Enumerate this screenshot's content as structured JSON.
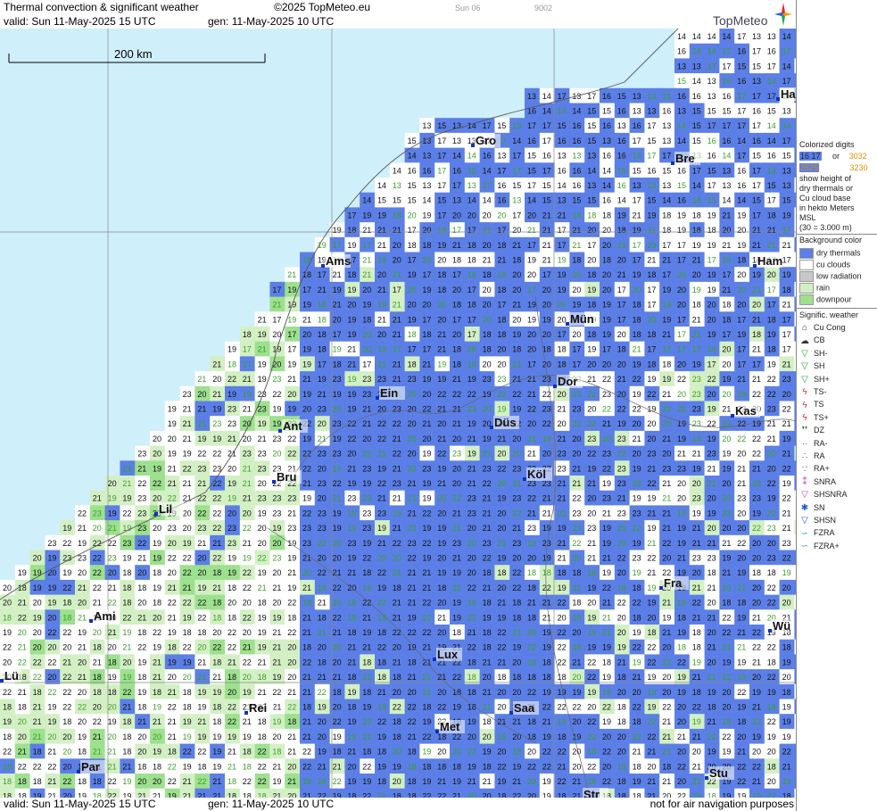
{
  "header": {
    "title": "Thermal convection & significant weather",
    "copyright": "©2025 TopMeteo.eu",
    "model_day": "Sun 06",
    "model_code": "9002",
    "valid": "valid:  Sun  11-May-2025  15 UTC",
    "gen": "gen: 11-May-2025 10 UTC"
  },
  "brand": {
    "name": "TopMeteo"
  },
  "map": {
    "scale_label": "200 km",
    "colors": {
      "sea": "#cfeffb",
      "dry": "#5b7fe6",
      "cu": "#ffffff",
      "rain": "#d3f0c4",
      "downpour": "#9de08e",
      "low": "#c8c8c8"
    },
    "cities": [
      "Ha",
      "Bre",
      "Gro",
      "Ams",
      "Ham",
      "Mün",
      "Dor",
      "Ein",
      "Kas",
      "Ant",
      "Düs",
      "Bru",
      "Köl",
      "Lil",
      "Fra",
      "Ami",
      "Wü",
      "Lux",
      "Rei",
      "Saa",
      "Met",
      "Par",
      "Stu",
      "Str",
      "Lü"
    ]
  },
  "legend": {
    "colorized_title": "Colorized digits",
    "sample_a": "16 17",
    "sample_a2": "2525",
    "or": "or",
    "sample_b": "3032",
    "sample_b2": "3230",
    "desc1": "show height of",
    "desc2": "dry thermals or",
    "desc3": "Cu cloud base",
    "desc4": "in hekto Meters",
    "desc5": "MSL",
    "desc6": "(30 = 3.000 m)",
    "bg_title": "Background color",
    "bg_items": [
      "dry thermals",
      "cu clouds",
      "low radiation",
      "rain",
      "downpour"
    ],
    "wx_title": "Signific. weather",
    "wx_items": [
      "Cu Cong",
      "CB",
      "SH-",
      "SH",
      "SH+",
      "TS-",
      "TS",
      "TS+",
      "DZ",
      "RA-",
      "RA",
      "RA+",
      "SNRA",
      "SHSNRA",
      "SN",
      "SHSN",
      "FZRA",
      "FZRA+"
    ],
    "wx_icons": [
      "cu-cong-icon",
      "cb-icon",
      "shower-light-icon",
      "shower-icon",
      "shower-heavy-icon",
      "thunderstorm-light-icon",
      "thunderstorm-icon",
      "thunderstorm-heavy-icon",
      "drizzle-icon",
      "rain-light-icon",
      "rain-icon",
      "rain-heavy-icon",
      "snow-rain-icon",
      "snow-rain-shower-icon",
      "snow-icon",
      "snow-shower-icon",
      "freezing-rain-icon",
      "freezing-rain-heavy-icon"
    ]
  },
  "footer": {
    "valid": "valid:  Sun  11-May-2025  15 UTC",
    "gen": "gen: 11-May-2025 10 UTC",
    "disclaimer": "not for air navigation purposes"
  }
}
